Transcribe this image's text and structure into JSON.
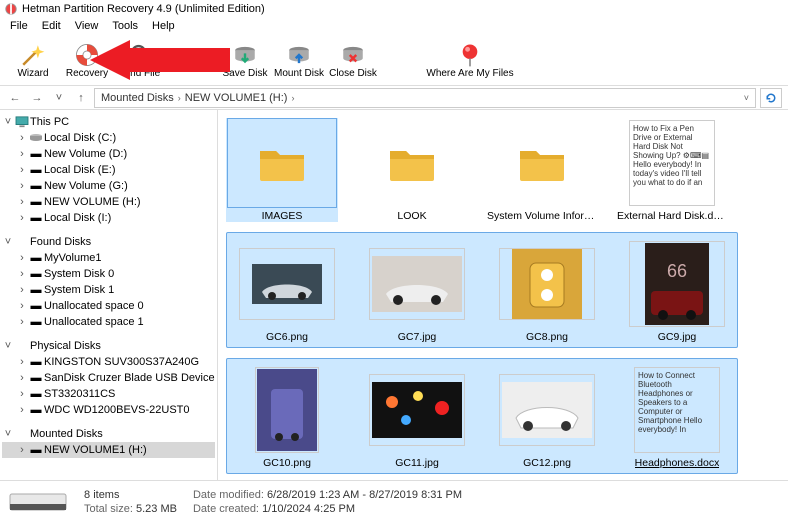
{
  "titlebar": {
    "title": "Hetman Partition Recovery 4.9 (Unlimited Edition)"
  },
  "menu": [
    "File",
    "Edit",
    "View",
    "Tools",
    "Help"
  ],
  "toolbar": [
    {
      "id": "wizard",
      "label": "Wizard"
    },
    {
      "id": "recovery",
      "label": "Recovery"
    },
    {
      "id": "findfile",
      "label": "Find File"
    },
    {
      "id": "savedisk",
      "label": "Save Disk"
    },
    {
      "id": "mountdisk",
      "label": "Mount Disk"
    },
    {
      "id": "closedisk",
      "label": "Close Disk"
    },
    {
      "id": "wherefiles",
      "label": "Where Are My Files"
    }
  ],
  "nav": {
    "back": "←",
    "fwd": "→",
    "down": "˅",
    "up": "↑",
    "crumbs": [
      "Mounted Disks",
      "NEW VOLUME1 (H:)"
    ]
  },
  "tree": {
    "thispc": {
      "label": "This PC",
      "children": [
        "Local Disk (C:)",
        "New Volume (D:)",
        "Local Disk (E:)",
        "New Volume (G:)",
        "NEW VOLUME (H:)",
        "Local Disk (I:)"
      ]
    },
    "found": {
      "label": "Found Disks",
      "children": [
        "MyVolume1",
        "System Disk 0",
        "System Disk 1",
        "Unallocated space 0",
        "Unallocated space 1"
      ]
    },
    "physical": {
      "label": "Physical Disks",
      "children": [
        "KINGSTON SUV300S37A240G",
        "SanDisk Cruzer Blade USB Device",
        "ST3320311CS",
        "WDC WD1200BEVS-22UST0"
      ]
    },
    "mounted": {
      "label": "Mounted Disks",
      "children": [
        "NEW VOLUME1 (H:)"
      ]
    }
  },
  "content": {
    "row1": [
      {
        "type": "folder",
        "name": "IMAGES",
        "selected": true
      },
      {
        "type": "folder",
        "name": "LOOK"
      },
      {
        "type": "folder",
        "name": "System Volume Information"
      },
      {
        "type": "doc",
        "name": "External Hard Disk.docx",
        "preview": "How to Fix a Pen Drive or External Hard Disk Not Showing Up? ⚙⌨▤\n\nHello everybody! In today's video I'll tell you what to do if an"
      }
    ],
    "row2": [
      {
        "type": "img",
        "name": "GC6.png",
        "bg": "#3a4a55"
      },
      {
        "type": "img",
        "name": "GC7.jpg",
        "bg": "#d7d2cc"
      },
      {
        "type": "img",
        "name": "GC8.png",
        "bg": "#f3c24a"
      },
      {
        "type": "img",
        "name": "GC9.jpg",
        "bg": "#2a1e1a"
      }
    ],
    "row3": [
      {
        "type": "img",
        "name": "GC10.png",
        "bg": "#5a5a9a"
      },
      {
        "type": "img",
        "name": "GC11.jpg",
        "bg": "#1a1a1a"
      },
      {
        "type": "img",
        "name": "GC12.png",
        "bg": "#e8e8e8"
      },
      {
        "type": "doc",
        "name": "Headphones.docx",
        "preview": "How to Connect Bluetooth Headphones or Speakers to a Computer or Smartphone\n\nHello everybody! In"
      }
    ]
  },
  "status": {
    "items_label": "items",
    "items": "8",
    "size_label": "Total size:",
    "size": "5.23 MB",
    "mod_label": "Date modified:",
    "mod": "6/28/2019 1:23 AM - 8/27/2019 8:31 PM",
    "crt_label": "Date created:",
    "crt": "1/10/2024 4:25 PM"
  }
}
